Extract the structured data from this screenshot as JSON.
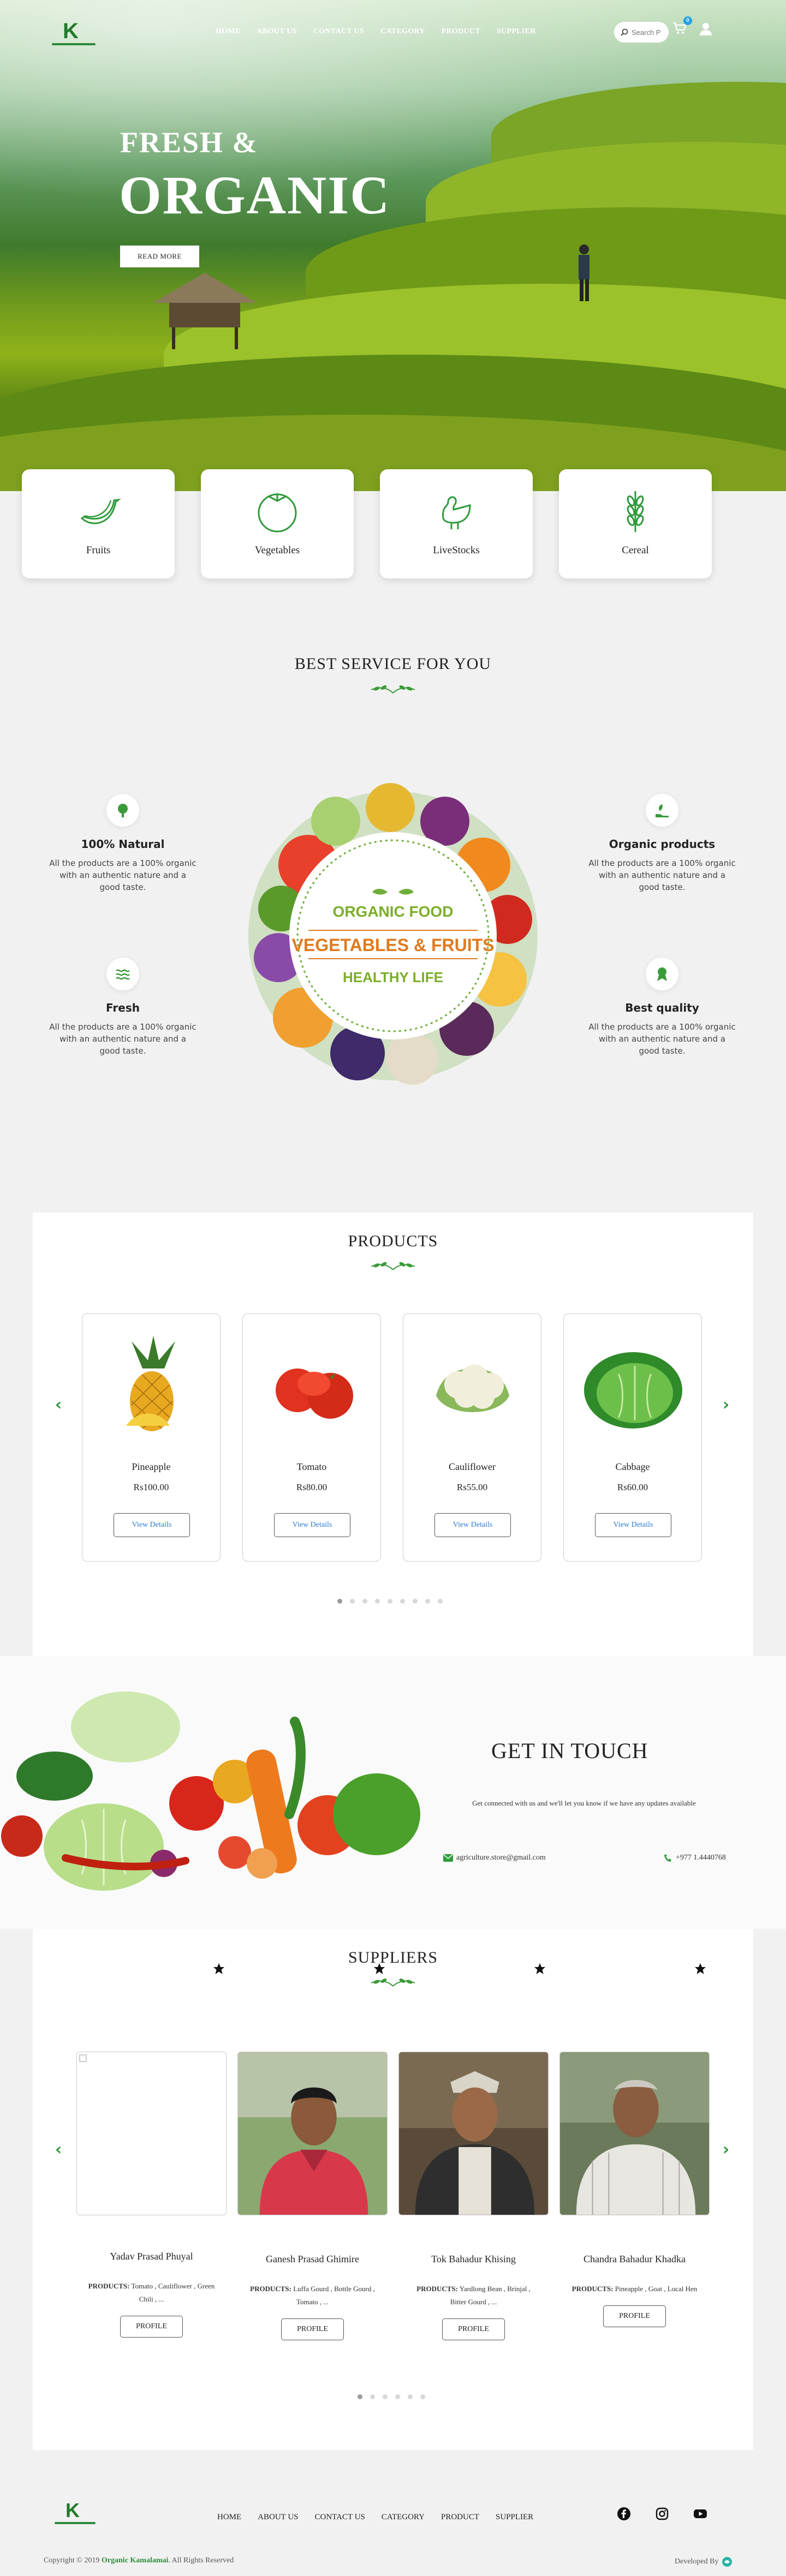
{
  "nav": {
    "logo_alt": "K",
    "items": [
      "HOME",
      "ABOUT US",
      "CONTACT US",
      "CATEGORY",
      "PRODUCT",
      "SUPPLIER"
    ],
    "search_placeholder": "Search P",
    "cart_count": "0"
  },
  "hero": {
    "line1": "FRESH &",
    "line2": "ORGANIC",
    "button": "READ MORE"
  },
  "categories": [
    "Fruits",
    "Vegetables",
    "LiveStocks",
    "Cereal"
  ],
  "service": {
    "title": "BEST SERVICE FOR YOU",
    "features": [
      {
        "title": "100% Natural",
        "text": "All the products are a 100% organic with an authentic nature and a good taste."
      },
      {
        "title": "Organic products",
        "text": "All the products are a 100% organic with an authentic nature and a good taste."
      },
      {
        "title": "Fresh",
        "text": "All the products are a 100% organic with an authentic nature and a good taste."
      },
      {
        "title": "Best quality",
        "text": "All the products are a 100% organic with an authentic nature and a good taste."
      }
    ],
    "wreath": {
      "line1": "ORGANIC FOOD",
      "line2": "VEGETABLES & FRUITS",
      "line3": "HEALTHY LIFE"
    }
  },
  "products": {
    "title": "PRODUCTS",
    "items": [
      {
        "name": "Pineapple",
        "price": "Rs100.00",
        "button": "View Details"
      },
      {
        "name": "Tomato",
        "price": "Rs80.00",
        "button": "View Details"
      },
      {
        "name": "Cauliflower",
        "price": "Rs55.00",
        "button": "View Details"
      },
      {
        "name": "Cabbage",
        "price": "Rs60.00",
        "button": "View Details"
      }
    ],
    "prev": "‹",
    "next": "›"
  },
  "contact": {
    "title": "GET IN TOUCH",
    "subtitle": "Get connected with us and we'll let you know if we have any updates available",
    "email": "agriculture.store@gmail.com",
    "phone": "+977 1.4440768"
  },
  "suppliers": {
    "title": "SUPPLIERS",
    "products_label": "PRODUCTS:",
    "button": "PROFILE",
    "items": [
      {
        "name": "Yadav Prasad Phuyal",
        "products": "Tomato , Cauliflower , Green Chili , ..."
      },
      {
        "name": "Ganesh Prasad Ghimire",
        "products": "Luffa Gourd , Bottle Gourd , Tomato , ..."
      },
      {
        "name": "Tok Bahadur Khising",
        "products": "Yardlong Bean , Brinjal , Bitter Gourd , ..."
      },
      {
        "name": "Chandra Bahadur Khadka",
        "products": "Pineapple , Goat , Local Hen"
      }
    ]
  },
  "footer": {
    "items": [
      "HOME",
      "ABOUT US",
      "CONTACT US",
      "CATEGORY",
      "PRODUCT",
      "SUPPLIER"
    ],
    "copyright_prefix": "Copyright © 2019",
    "brand": "Organic Kamalamai",
    "copyright_suffix": ". All Rights Reserved",
    "developed_by": "Developed By"
  },
  "colors": {
    "accent": "#2e9a3a",
    "link": "#2a7bd1",
    "badge": "#23a0e6"
  }
}
